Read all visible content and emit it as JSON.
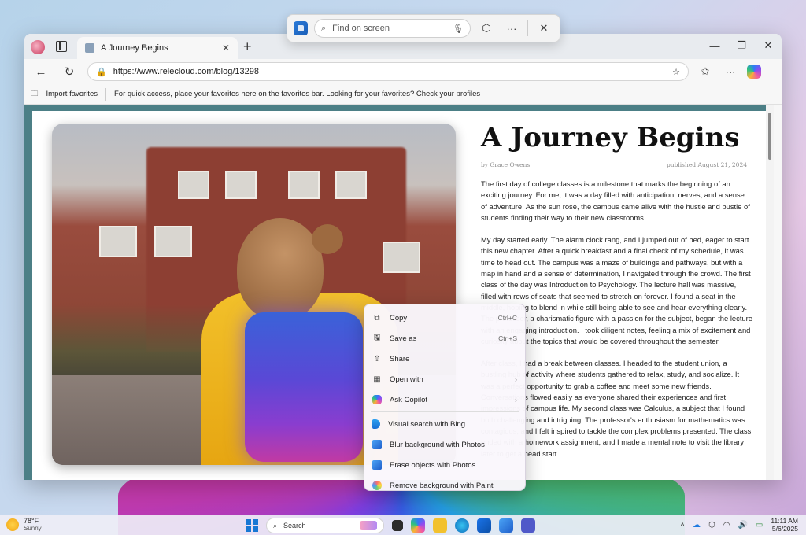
{
  "find_bar": {
    "placeholder": "Find on screen"
  },
  "browser": {
    "tab": {
      "title": "A Journey Begins"
    },
    "address": {
      "url": "https://www.relecloud.com/blog/13298"
    },
    "favorites_bar": {
      "import_label": "Import favorites",
      "hint": "For quick access, place your favorites here on the favorites bar. Looking for your favorites? Check your profiles"
    }
  },
  "article": {
    "title": "A Journey Begins",
    "author": "by Grace Owens",
    "published": "published August 21, 2024",
    "paragraphs": [
      "The first day of college classes is a milestone that marks the beginning of an exciting journey. For me, it was a day filled with anticipation, nerves, and a sense of adventure. As the sun rose, the campus came alive with the hustle and bustle of students finding their way to their new classrooms.",
      "My day started early. The alarm clock rang, and I jumped out of bed, eager to start this new chapter. After a quick breakfast and a final check of my schedule, it was time to head out. The campus was a maze of buildings and pathways, but with a map in hand and a sense of determination, I navigated through the crowd. The first class of the day was Introduction to Psychology. The lecture hall was massive, filled with rows of seats that seemed to stretch on forever. I found a seat in the middle, hoping to blend in while still being able to see and hear everything clearly. The professor, a charismatic figure with a passion for the subject, began the lecture with an engaging introduction. I took diligent notes, feeling a mix of excitement and curiosity about the topics that would be covered throughout the semester.",
      "After class, I had a break between classes. I headed to the student union, a bustling hub of activity where students gathered to relax, study, and socialize. It was a perfect opportunity to grab a coffee and meet some new friends. Conversations flowed easily as everyone shared their experiences and first impressions of campus life. My second class was Calculus, a subject that I found both challenging and intriguing. The professor's enthusiasm for mathematics was contagious, and I felt inspired to tackle the complex problems presented. The class ended with a homework assignment, and I made a mental note to visit the library later to get a head start."
    ]
  },
  "context_menu": {
    "items": [
      {
        "label": "Copy",
        "shortcut": "Ctrl+C",
        "icon": "copy-icon"
      },
      {
        "label": "Save as",
        "shortcut": "Ctrl+S",
        "icon": "save-icon"
      },
      {
        "label": "Share",
        "shortcut": "",
        "icon": "share-icon"
      },
      {
        "label": "Open with",
        "shortcut": "",
        "icon": "open-with-icon"
      },
      {
        "label": "Ask Copilot",
        "shortcut": "",
        "icon": "copilot-icon"
      },
      {
        "label": "Visual search with Bing",
        "shortcut": "",
        "icon": "bing-icon"
      },
      {
        "label": "Blur background with Photos",
        "shortcut": "",
        "icon": "photos-icon"
      },
      {
        "label": "Erase objects with Photos",
        "shortcut": "",
        "icon": "photos-icon"
      },
      {
        "label": "Remove background with Paint",
        "shortcut": "",
        "icon": "paint-icon"
      }
    ]
  },
  "taskbar": {
    "weather": {
      "temp": "78°F",
      "condition": "Sunny"
    },
    "search_placeholder": "Search",
    "clock": {
      "time": "11:11 AM",
      "date": "5/6/2025"
    }
  }
}
